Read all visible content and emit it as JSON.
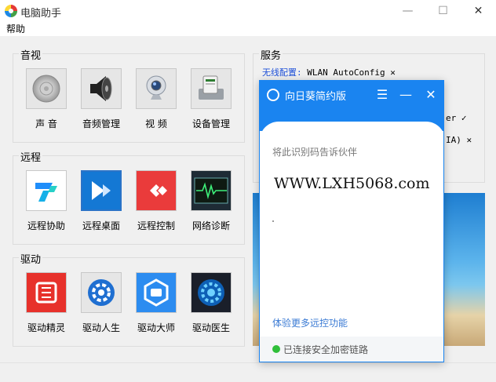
{
  "window": {
    "title": "电脑助手",
    "minimize": "—",
    "maximize": "☐",
    "close": "✕"
  },
  "menu": {
    "help": "帮助"
  },
  "groups": [
    {
      "title": "音视",
      "items": [
        {
          "label": "声  音",
          "icon": "speaker-icon"
        },
        {
          "label": "音频管理",
          "icon": "loudspeaker-icon"
        },
        {
          "label": "视  频",
          "icon": "webcam-icon"
        },
        {
          "label": "设备管理",
          "icon": "device-manager-icon"
        }
      ]
    },
    {
      "title": "远程",
      "items": [
        {
          "label": "远程协助",
          "icon": "todesk-icon"
        },
        {
          "label": "远程桌面",
          "icon": "remote-desktop-icon"
        },
        {
          "label": "远程控制",
          "icon": "remote-control-icon"
        },
        {
          "label": "网络诊断",
          "icon": "network-diagnosis-icon"
        }
      ]
    },
    {
      "title": "驱动",
      "items": [
        {
          "label": "驱动精灵",
          "icon": "driver-genius-icon"
        },
        {
          "label": "驱动人生",
          "icon": "driver-life-icon"
        },
        {
          "label": "驱动大师",
          "icon": "driver-master-icon"
        },
        {
          "label": "驱动医生",
          "icon": "driver-doctor-icon"
        }
      ]
    }
  ],
  "service": {
    "title": "服务",
    "row1_key": "无线配置:",
    "row1_value": "WLAN AutoConfig",
    "row1_close": "✕",
    "row2_tail": "er ✓",
    "row3_tail": "IA) ✕"
  },
  "overlay": {
    "title": "向日葵简约版",
    "menu_icon": "☰",
    "minimize_icon": "—",
    "close_icon": "✕",
    "hint": "将此识别码告诉伙伴",
    "code": "WWW.LXH5068.com",
    "more_link": "体验更多远控功能",
    "status": "已连接安全加密链路"
  },
  "colors": {
    "accent": "#1a84f0",
    "link": "#1d4fd8",
    "status_ok": "#2fbf3a"
  }
}
